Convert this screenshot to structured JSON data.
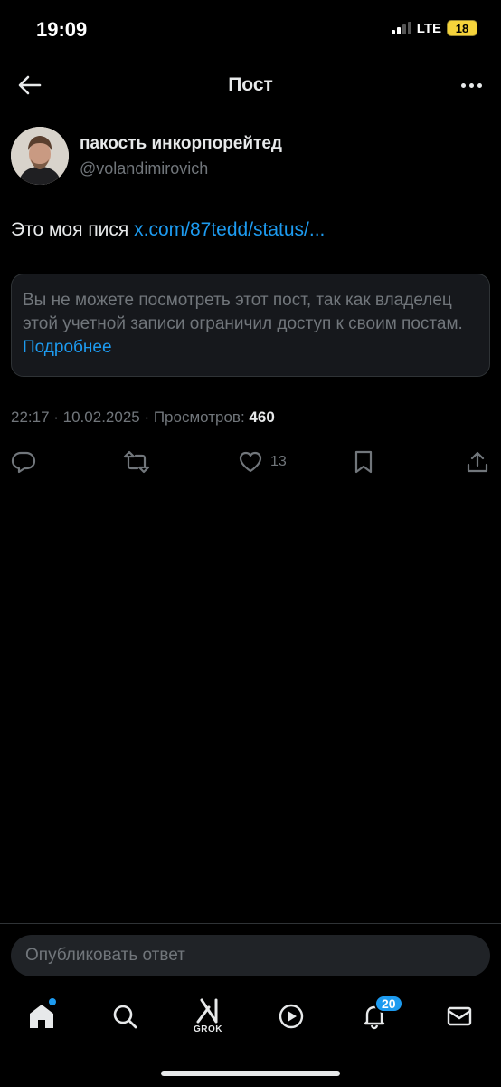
{
  "status_bar": {
    "time": "19:09",
    "network": "LTE",
    "battery": "18"
  },
  "header": {
    "title": "Пост"
  },
  "post": {
    "author_name": "пакость инкорпорейтед",
    "author_handle": "@volandimirovich",
    "text": "Это моя пися ",
    "link": "x.com/87tedd/status/...",
    "notice_text": "Вы не можете посмотреть этот пост, так как владелец этой учетной записи ограничил доступ к своим постам. ",
    "notice_link": "Подробнее",
    "timestamp": "22:17 · 10.02.2025 · Просмотров: ",
    "views": "460",
    "likes": "13"
  },
  "reply": {
    "placeholder": "Опубликовать ответ"
  },
  "tabbar": {
    "grok_label": "GROK",
    "notifications_badge": "20"
  },
  "colors": {
    "accent": "#1d9bf0",
    "background": "#000000",
    "secondary_text": "#71767b"
  }
}
